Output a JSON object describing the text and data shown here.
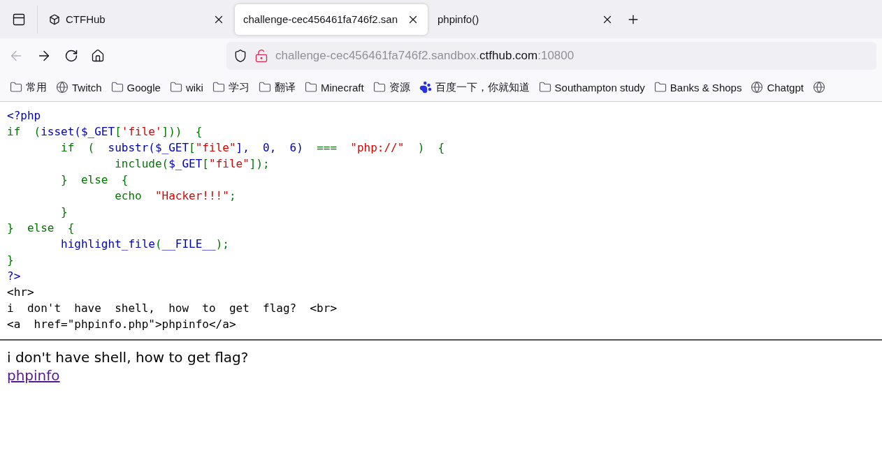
{
  "tabs": [
    {
      "title": "CTFHub",
      "selected": false
    },
    {
      "title": "challenge-cec456461fa746f2.san",
      "selected": true
    },
    {
      "title": "phpinfo()",
      "selected": false
    }
  ],
  "address": {
    "prefix": "challenge-cec456461fa746f2.sandbox.",
    "domain": "ctfhub.com",
    "suffix": ":10800"
  },
  "bookmarks": [
    {
      "kind": "folder",
      "label": "常用"
    },
    {
      "kind": "globe",
      "label": "Twitch"
    },
    {
      "kind": "folder",
      "label": "Google"
    },
    {
      "kind": "folder",
      "label": "wiki"
    },
    {
      "kind": "folder",
      "label": "学习"
    },
    {
      "kind": "folder",
      "label": "翻译"
    },
    {
      "kind": "folder",
      "label": "Minecraft"
    },
    {
      "kind": "folder",
      "label": "资源"
    },
    {
      "kind": "paw",
      "label": "百度一下，你就知道"
    },
    {
      "kind": "folder",
      "label": "Southampton study"
    },
    {
      "kind": "folder",
      "label": "Banks & Shops"
    },
    {
      "kind": "globe",
      "label": "Chatgpt"
    },
    {
      "kind": "globe"
    }
  ],
  "source": [
    [
      {
        "kind": "default",
        "text": "<?php"
      }
    ],
    [
      {
        "kind": "keyword",
        "text": "if  ("
      },
      {
        "kind": "default",
        "text": "isset($_GET"
      },
      {
        "kind": "keyword",
        "text": "["
      },
      {
        "kind": "string",
        "text": "'file'"
      },
      {
        "kind": "keyword",
        "text": "]))  {"
      }
    ],
    [
      {
        "kind": "keyword",
        "text": "        if  (  "
      },
      {
        "kind": "default",
        "text": "substr($_GET"
      },
      {
        "kind": "keyword",
        "text": "["
      },
      {
        "kind": "string",
        "text": "\"file\""
      },
      {
        "kind": "default",
        "text": "],  0,  6)  "
      },
      {
        "kind": "keyword",
        "text": "===  "
      },
      {
        "kind": "string",
        "text": "\"php://\""
      },
      {
        "kind": "keyword",
        "text": "  )  {"
      }
    ],
    [
      {
        "kind": "keyword",
        "text": "                include("
      },
      {
        "kind": "default",
        "text": "$_GET"
      },
      {
        "kind": "keyword",
        "text": "["
      },
      {
        "kind": "string",
        "text": "\"file\""
      },
      {
        "kind": "keyword",
        "text": "]);"
      }
    ],
    [
      {
        "kind": "keyword",
        "text": "        }  else  {"
      }
    ],
    [
      {
        "kind": "keyword",
        "text": "                echo  "
      },
      {
        "kind": "string",
        "text": "\"Hacker!!!\""
      },
      {
        "kind": "keyword",
        "text": ";"
      }
    ],
    [
      {
        "kind": "keyword",
        "text": "        }"
      }
    ],
    [
      {
        "kind": "keyword",
        "text": "}  else  {"
      }
    ],
    [
      {
        "kind": "default",
        "text": "        highlight_file"
      },
      {
        "kind": "keyword",
        "text": "("
      },
      {
        "kind": "default",
        "text": "__FILE__"
      },
      {
        "kind": "keyword",
        "text": ");"
      }
    ],
    [
      {
        "kind": "keyword",
        "text": "}"
      }
    ],
    [
      {
        "kind": "default",
        "text": "?>"
      }
    ],
    [
      {
        "kind": "html",
        "text": "<hr>"
      }
    ],
    [
      {
        "kind": "html",
        "text": "i  don't  have  shell,  how  to  get  flag?  <br>"
      }
    ],
    [
      {
        "kind": "html",
        "text": "<a  href=\"phpinfo.php\">phpinfo</a>"
      }
    ]
  ],
  "message": "i don't have shell, how to get flag?",
  "link": {
    "text": "phpinfo",
    "visited": true
  }
}
